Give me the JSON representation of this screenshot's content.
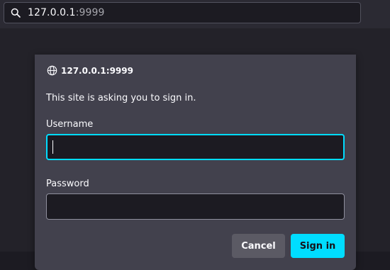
{
  "urlbar": {
    "host": "127.0.0.1",
    "port": ":9999",
    "search_icon": "search-icon"
  },
  "dialog": {
    "origin": "127.0.0.1:9999",
    "origin_icon": "globe-icon",
    "message": "This site is asking you to sign in.",
    "username_label": "Username",
    "username_value": "",
    "password_label": "Password",
    "password_value": "",
    "cancel_label": "Cancel",
    "signin_label": "Sign in"
  },
  "colors": {
    "accent": "#00ddff",
    "dialog_bg": "#42414d",
    "toolbar_bg": "#2b2a33",
    "field_bg": "#1c1b22"
  }
}
